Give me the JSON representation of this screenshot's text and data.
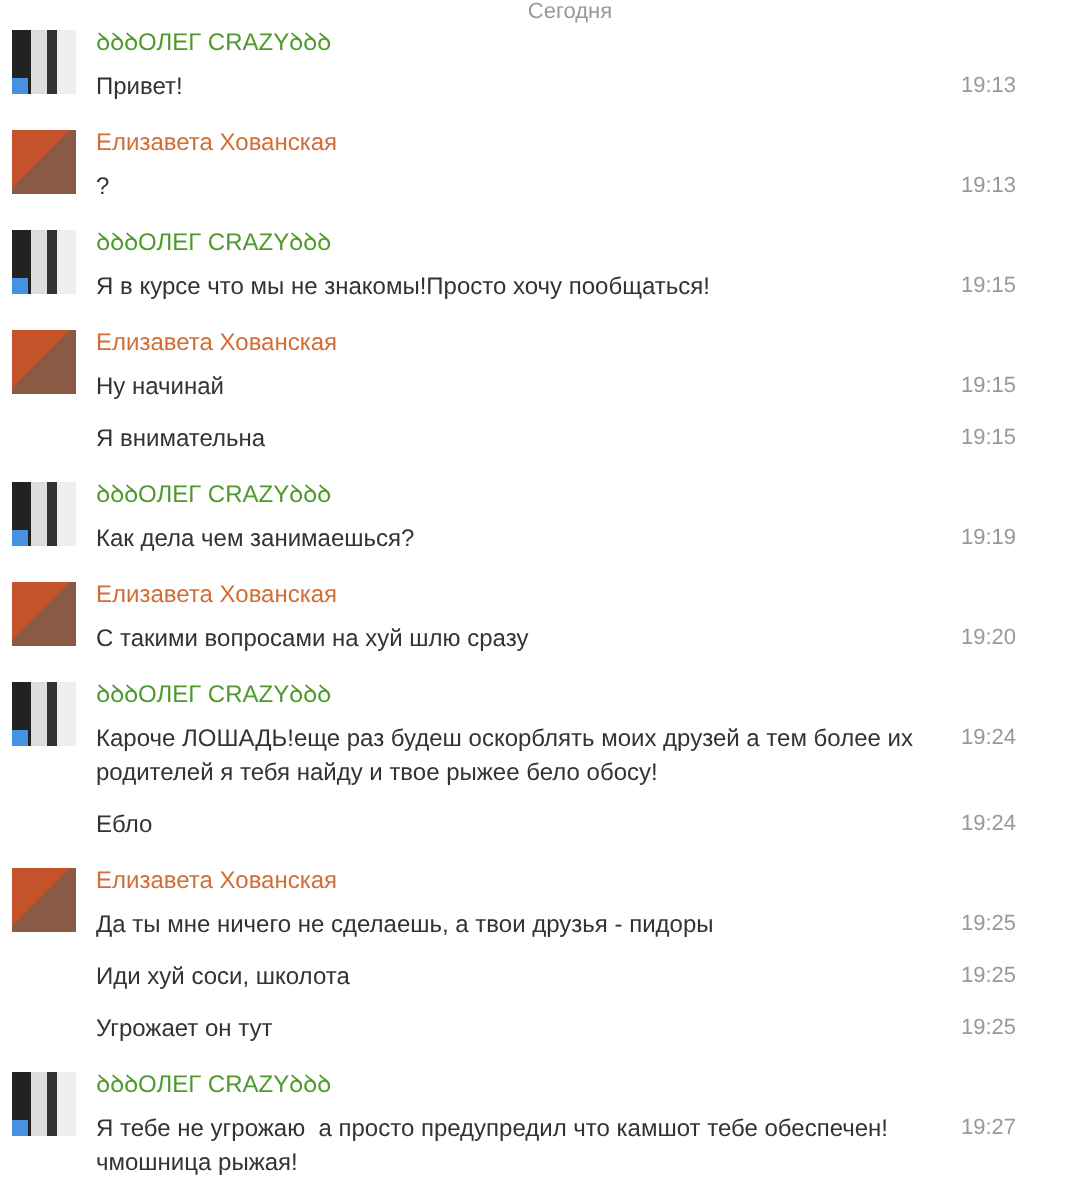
{
  "day_label": "Сегодня",
  "groups": [
    {
      "author": "ꝺꝺꝺОЛЕГ CRAZYꝺꝺꝺ",
      "color": "#4f9a2c",
      "kind": "mono",
      "online": true,
      "messages": [
        {
          "text": "Привет!",
          "time": "19:13"
        }
      ]
    },
    {
      "author": "Елизавета Хованская",
      "color": "#d06e36",
      "kind": "color",
      "online": false,
      "messages": [
        {
          "text": "?",
          "time": "19:13"
        }
      ]
    },
    {
      "author": "ꝺꝺꝺОЛЕГ CRAZYꝺꝺꝺ",
      "color": "#4f9a2c",
      "kind": "mono",
      "online": true,
      "messages": [
        {
          "text": "Я в курсе что мы не знакомы!Просто хочу пообщаться!",
          "time": "19:15"
        }
      ]
    },
    {
      "author": "Елизавета Хованская",
      "color": "#d06e36",
      "kind": "color",
      "online": false,
      "messages": [
        {
          "text": "Ну начинай",
          "time": "19:15"
        },
        {
          "text": "Я внимательна",
          "time": "19:15"
        }
      ]
    },
    {
      "author": "ꝺꝺꝺОЛЕГ CRAZYꝺꝺꝺ",
      "color": "#4f9a2c",
      "kind": "mono",
      "online": true,
      "messages": [
        {
          "text": "Как дела чем занимаешься?",
          "time": "19:19"
        }
      ]
    },
    {
      "author": "Елизавета Хованская",
      "color": "#d06e36",
      "kind": "color",
      "online": false,
      "messages": [
        {
          "text": "С такими вопросами на хуй шлю сразу",
          "time": "19:20"
        }
      ]
    },
    {
      "author": "ꝺꝺꝺОЛЕГ CRAZYꝺꝺꝺ",
      "color": "#4f9a2c",
      "kind": "mono",
      "online": true,
      "messages": [
        {
          "text": "Кароче ЛОШАДЬ!еще раз будеш оскорблять моих друзей а тем более их родителей я тебя найду и твое рыжее бело обосу!",
          "time": "19:24"
        },
        {
          "text": "Ебло",
          "time": "19:24"
        }
      ]
    },
    {
      "author": "Елизавета Хованская",
      "color": "#d06e36",
      "kind": "color",
      "online": false,
      "messages": [
        {
          "text": "Да ты мне ничего не сделаешь, а твои друзья - пидоры",
          "time": "19:25"
        },
        {
          "text": "Иди хуй соси, школота",
          "time": "19:25"
        },
        {
          "text": "Угрожает он тут",
          "time": "19:25"
        }
      ]
    },
    {
      "author": "ꝺꝺꝺОЛЕГ CRAZYꝺꝺꝺ",
      "color": "#4f9a2c",
      "kind": "mono",
      "online": true,
      "messages": [
        {
          "text": "Я тебе не угрожаю  а просто предупредил что камшот тебе обеспечен! чмошница рыжая!",
          "time": "19:27"
        }
      ]
    }
  ]
}
